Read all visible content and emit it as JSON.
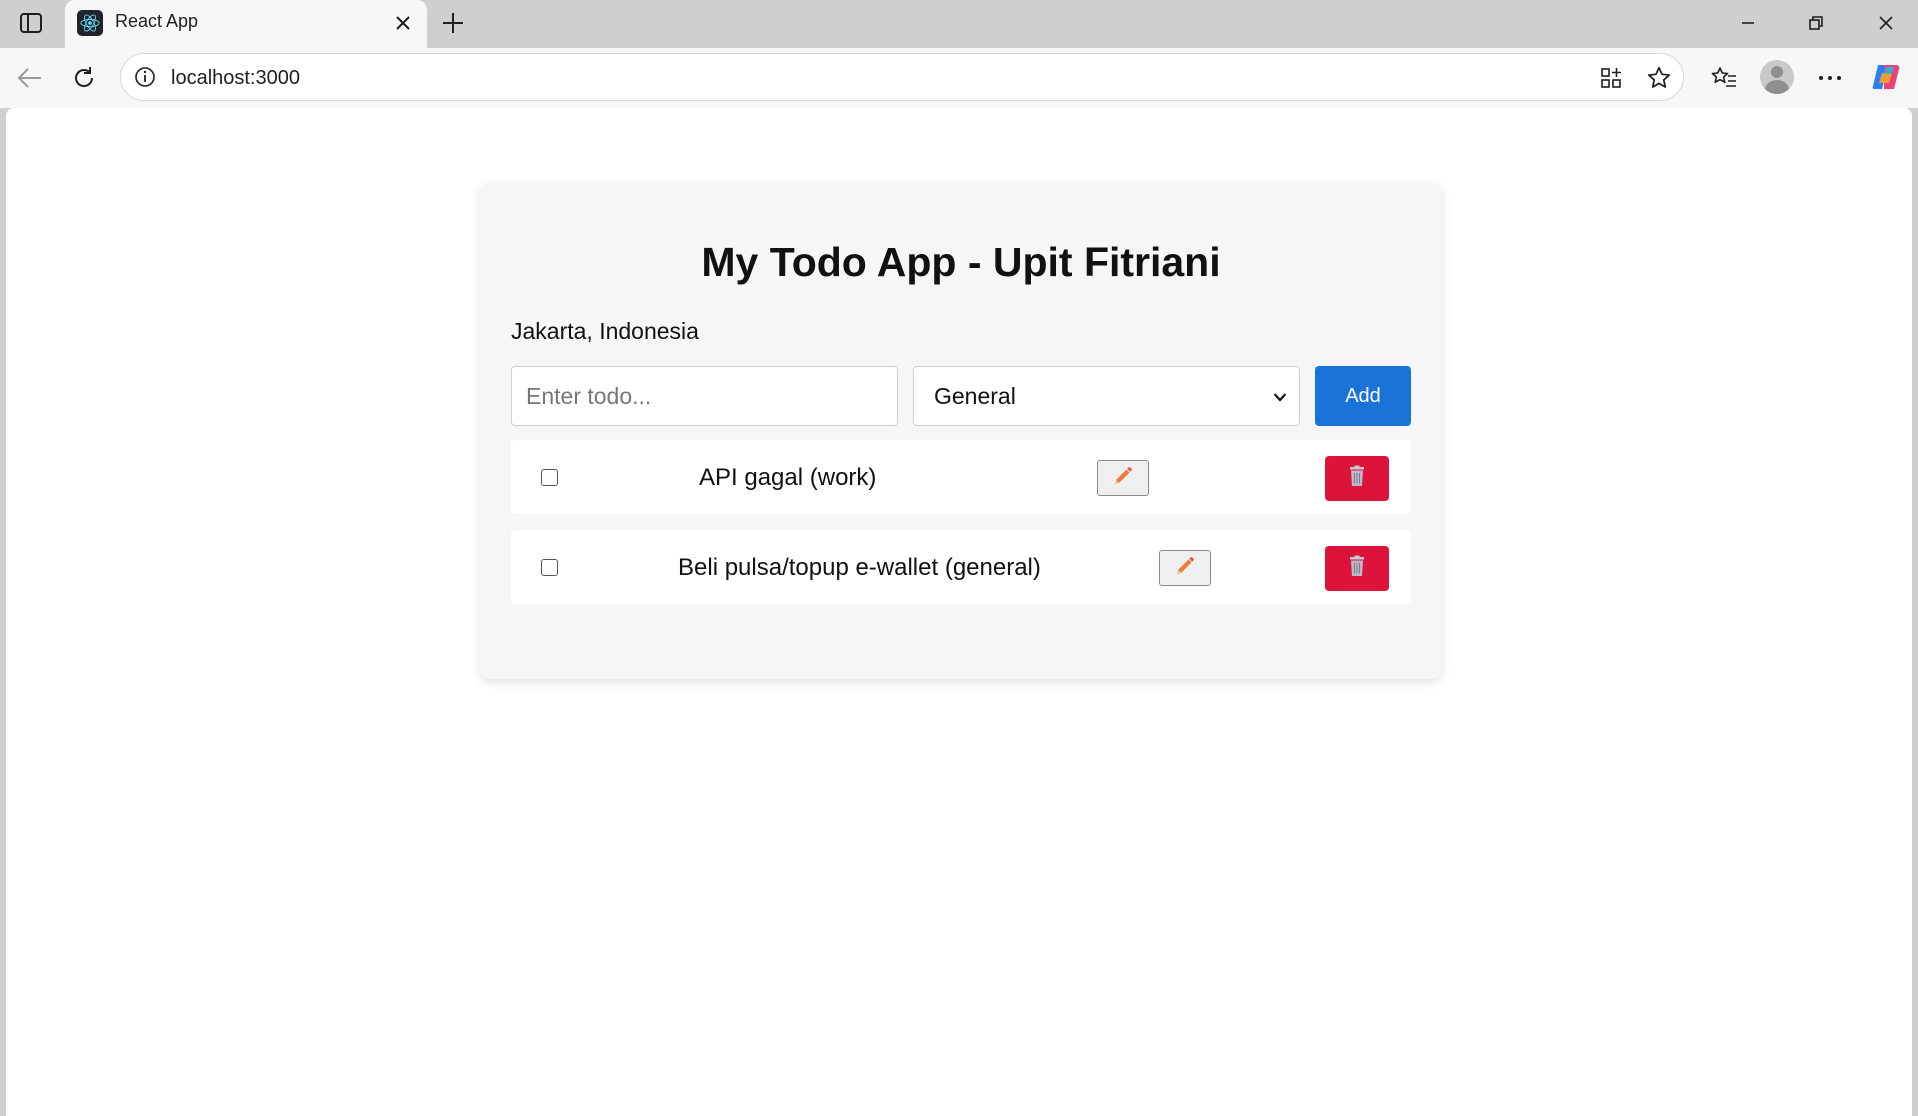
{
  "browser": {
    "tab": {
      "title": "React App"
    },
    "address_bar": {
      "url": "localhost:3000"
    }
  },
  "app": {
    "title": "My Todo App - Upit Fitriani",
    "location": "Jakarta, Indonesia",
    "form": {
      "input_placeholder": "Enter todo...",
      "input_value": "",
      "category_selected": "General",
      "add_label": "Add"
    },
    "todos": [
      {
        "text": "API gagal (work)",
        "completed": false
      },
      {
        "text": "Beli pulsa/topup e-wallet (general)",
        "completed": false
      }
    ]
  },
  "icons": {
    "edit": "pencil-icon",
    "delete": "trash-icon"
  },
  "colors": {
    "add_button": "#1a73d9",
    "delete_button": "#dc143c",
    "card_background": "#f6f6f6",
    "pencil": "#f07a3a"
  }
}
